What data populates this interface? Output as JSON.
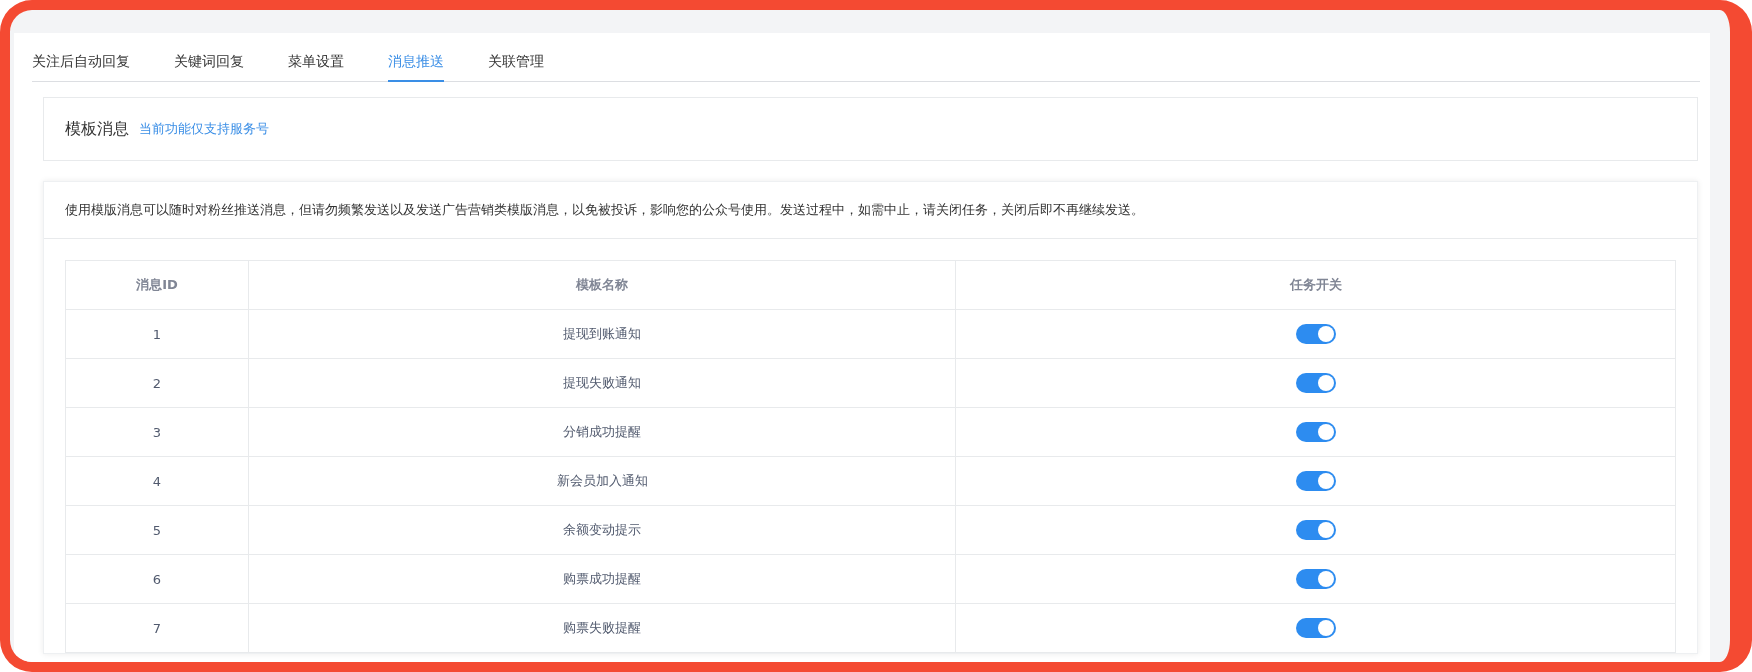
{
  "tabs": [
    {
      "label": "关注后自动回复",
      "selected": false
    },
    {
      "label": "关键词回复",
      "selected": false
    },
    {
      "label": "菜单设置",
      "selected": false
    },
    {
      "label": "消息推送",
      "selected": true
    },
    {
      "label": "关联管理",
      "selected": false
    }
  ],
  "header": {
    "title": "模板消息",
    "note": "当前功能仅支持服务号"
  },
  "notice": "使用模版消息可以随时对粉丝推送消息，但请勿频繁发送以及发送广告营销类模版消息，以免被投诉，影响您的公众号使用。发送过程中，如需中止，请关闭任务，关闭后即不再继续发送。",
  "table": {
    "columns": [
      "消息ID",
      "模板名称",
      "任务开关"
    ],
    "rows": [
      {
        "id": "1",
        "name": "提现到账通知",
        "on": true
      },
      {
        "id": "2",
        "name": "提现失败通知",
        "on": true
      },
      {
        "id": "3",
        "name": "分销成功提醒",
        "on": true
      },
      {
        "id": "4",
        "name": "新会员加入通知",
        "on": true
      },
      {
        "id": "5",
        "name": "余额变动提示",
        "on": true
      },
      {
        "id": "6",
        "name": "购票成功提醒",
        "on": true
      },
      {
        "id": "7",
        "name": "购票失败提醒",
        "on": true
      }
    ]
  }
}
